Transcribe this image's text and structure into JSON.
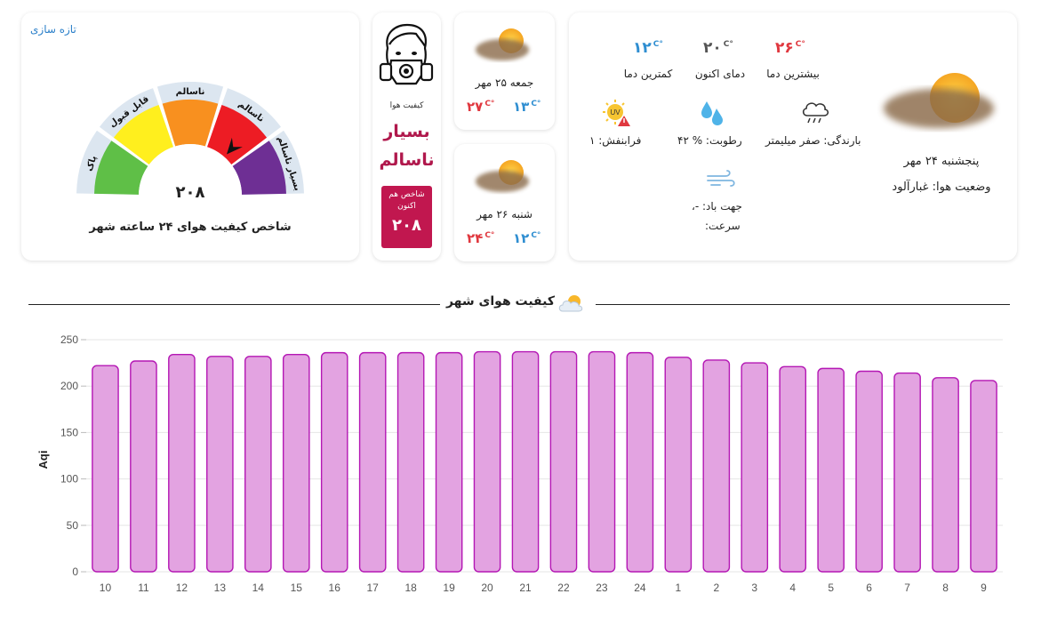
{
  "gauge": {
    "refresh_label": "تازه سازی",
    "value": "۲۰۸",
    "caption": "شاخص کیفیت هوای ۲۴ ساعته شهر",
    "segment_labels": [
      "پاک",
      "قابل قبول",
      "ناسالم",
      "ناسالم",
      "بسیار ناسالم"
    ],
    "segment_colors": [
      "#5fbf47",
      "#ffef1e",
      "#f8901f",
      "#ed1c24",
      "#6e2f94"
    ]
  },
  "quality": {
    "label": "کیفیت هوا",
    "status_line1": "بسیار",
    "status_line2": "ناسالم",
    "now_label": "شاخص هم اکنون",
    "now_value": "۲۰۸"
  },
  "forecast": [
    {
      "date": "جمعه ۲۵ مهر",
      "max": "۲۷",
      "min": "۱۳",
      "unit": "C°"
    },
    {
      "date": "شنبه ۲۶ مهر",
      "max": "۲۴",
      "min": "۱۲",
      "unit": "C°"
    }
  ],
  "current": {
    "date": "پنجشنبه ۲۴ مهر",
    "condition": "وضعیت هوا: غبارآلود",
    "max_value": "۲۶",
    "max_label": "بیشترین دما",
    "now_value": "۲۰",
    "now_label": "دمای اکنون",
    "min_value": "۱۲",
    "min_label": "کمترین دما",
    "unit": "C°",
    "rain": "بارندگی: صفر میلیمتر",
    "humidity": "رطوبت: % ۴۲",
    "uv": "فرابنفش: ۱",
    "uv_badge": "UV",
    "wind_dir": "جهت باد: -،",
    "wind_speed": "سرعت:"
  },
  "section_title": "کیفیت هوای شهر",
  "chart_data": {
    "type": "bar",
    "ylabel": "Aqi",
    "ylim": [
      0,
      250
    ],
    "yticks": [
      0,
      50,
      100,
      150,
      200,
      250
    ],
    "grid": true,
    "categories": [
      "10",
      "11",
      "12",
      "13",
      "14",
      "15",
      "16",
      "17",
      "18",
      "19",
      "20",
      "21",
      "22",
      "23",
      "24",
      "1",
      "2",
      "3",
      "4",
      "5",
      "6",
      "7",
      "8",
      "9"
    ],
    "values": [
      222,
      227,
      234,
      232,
      232,
      234,
      236,
      236,
      236,
      236,
      237,
      237,
      237,
      237,
      236,
      231,
      228,
      225,
      221,
      219,
      216,
      214,
      209,
      206
    ],
    "bar_fill": "#e3a3e1",
    "bar_stroke": "#b417b4"
  }
}
